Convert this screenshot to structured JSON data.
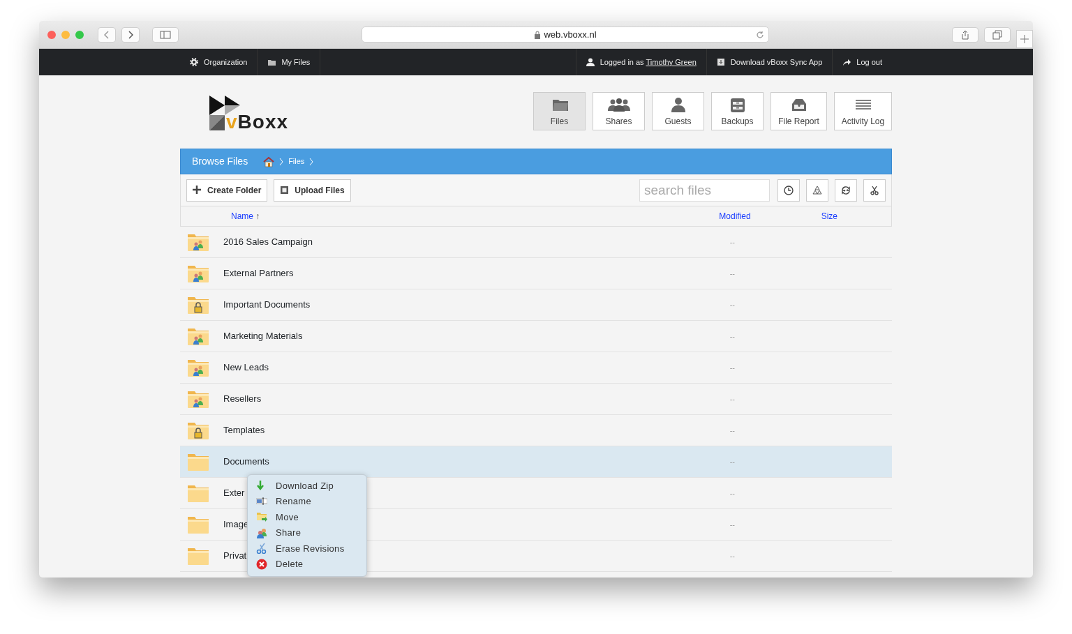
{
  "browser": {
    "url": "web.vboxx.nl"
  },
  "topbar": {
    "left": [
      {
        "kind": "gear",
        "label": "Organization"
      },
      {
        "kind": "folder",
        "label": "My Files"
      }
    ],
    "login_prefix": "Logged in as",
    "login_user": "Timothy Green",
    "right": [
      {
        "kind": "download",
        "label": "Download vBoxx Sync App"
      },
      {
        "kind": "logout",
        "label": "Log out"
      }
    ]
  },
  "logo": {
    "prefix": "v",
    "name": "Boxx"
  },
  "nav": [
    {
      "kind": "files",
      "label": "Files",
      "selected": true
    },
    {
      "kind": "shares",
      "label": "Shares",
      "selected": false
    },
    {
      "kind": "guests",
      "label": "Guests",
      "selected": false
    },
    {
      "kind": "backups",
      "label": "Backups",
      "selected": false
    },
    {
      "kind": "report",
      "label": "File Report",
      "selected": false
    },
    {
      "kind": "log",
      "label": "Activity Log",
      "selected": false
    }
  ],
  "title_bar": {
    "title": "Browse Files",
    "breadcrumb": [
      "Files"
    ]
  },
  "toolbar": {
    "buttons": [
      {
        "kind": "plus",
        "label": "Create Folder"
      },
      {
        "kind": "upload",
        "label": "Upload Files"
      }
    ],
    "search": {
      "placeholder": "search files"
    }
  },
  "table": {
    "columns": [
      {
        "label": "Name",
        "sort": "↑"
      },
      {
        "label": "Modified"
      },
      {
        "label": "Size"
      }
    ],
    "rows": [
      {
        "kind": "shared",
        "name": "2016 Sales Campaign",
        "modified": "--",
        "selected": false
      },
      {
        "kind": "shared",
        "name": "External Partners",
        "modified": "--",
        "selected": false
      },
      {
        "kind": "locked",
        "name": "Important Documents",
        "modified": "--",
        "selected": false
      },
      {
        "kind": "shared",
        "name": "Marketing Materials",
        "modified": "--",
        "selected": false
      },
      {
        "kind": "shared",
        "name": "New Leads",
        "modified": "--",
        "selected": false
      },
      {
        "kind": "shared",
        "name": "Resellers",
        "modified": "--",
        "selected": false
      },
      {
        "kind": "locked",
        "name": "Templates",
        "modified": "--",
        "selected": false
      },
      {
        "kind": "plain",
        "name": "Documents",
        "modified": "--",
        "selected": true
      },
      {
        "kind": "plain",
        "name": "Exter",
        "modified": "--",
        "selected": false
      },
      {
        "kind": "plain",
        "name": "Image",
        "modified": "--",
        "selected": false
      },
      {
        "kind": "plain",
        "name": "Privat",
        "modified": "--",
        "selected": false
      }
    ]
  },
  "context_menu": [
    {
      "kind": "download",
      "label": "Download Zip"
    },
    {
      "kind": "rename",
      "label": "Rename"
    },
    {
      "kind": "move",
      "label": "Move"
    },
    {
      "kind": "share",
      "label": "Share"
    },
    {
      "kind": "erase",
      "label": "Erase Revisions"
    },
    {
      "kind": "delete",
      "label": "Delete"
    }
  ]
}
